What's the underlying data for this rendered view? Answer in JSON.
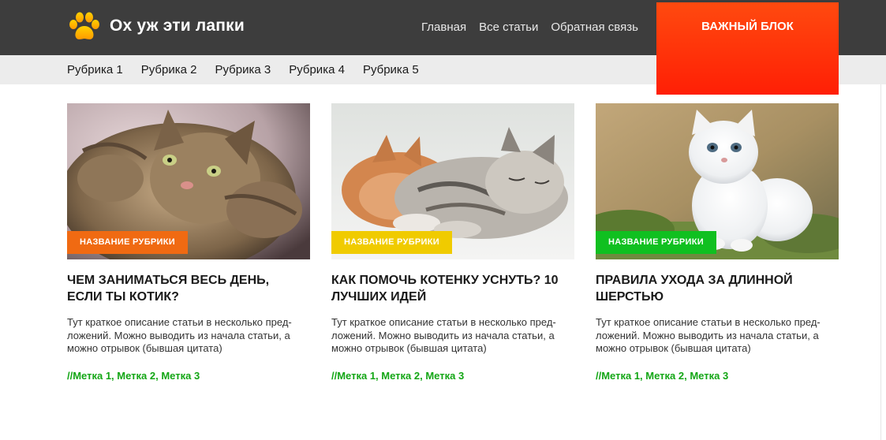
{
  "header": {
    "site_title": "Ох уж эти лапки",
    "nav": [
      "Главная",
      "Все статьи",
      "Обратная связь"
    ]
  },
  "important_block": {
    "label": "ВАЖНЫЙ БЛОК"
  },
  "subnav": {
    "items": [
      "Рубрика 1",
      "Рубрика 2",
      "Рубрика 3",
      "Рубрика 4",
      "Рубрика 5"
    ]
  },
  "colors": {
    "header_bg": "#3d3d3d",
    "accent_orange": "#ff3a0a",
    "badge_orange": "#f06a12",
    "badge_yellow": "#f0cb00",
    "badge_green": "#10c020",
    "tags_green": "#13a615"
  },
  "cards": [
    {
      "badge": "НАЗВАНИЕ РУБРИКИ",
      "title": "ЧЕМ ЗАНИМАТЬСЯ ВЕСЬ ДЕНЬ, ЕСЛИ ТЫ КОТИК?",
      "description": "Тут краткое описание статьи в несколько пред-ложений. Можно выводить из начала статьи, а можно отрывок (бывшая цитата)",
      "tags": "//Метка 1, Метка 2, Метка 3"
    },
    {
      "badge": "НАЗВАНИЕ РУБРИКИ",
      "title": "КАК ПОМОЧЬ КОТЕНКУ УСНУТЬ? 10 ЛУЧШИХ ИДЕЙ",
      "description": "Тут краткое описание статьи в несколько пред-ложений. Можно выводить из начала статьи, а можно отрывок (бывшая цитата)",
      "tags": "//Метка 1, Метка 2, Метка 3"
    },
    {
      "badge": "НАЗВАНИЕ РУБРИКИ",
      "title": "ПРАВИЛА УХОДА ЗА ДЛИННОЙ ШЕРСТЬЮ",
      "description": "Тут краткое описание статьи в несколько пред-ложений. Можно выводить из начала статьи, а можно отрывок (бывшая цитата)",
      "tags": "//Метка 1, Метка 2, Метка 3"
    }
  ]
}
